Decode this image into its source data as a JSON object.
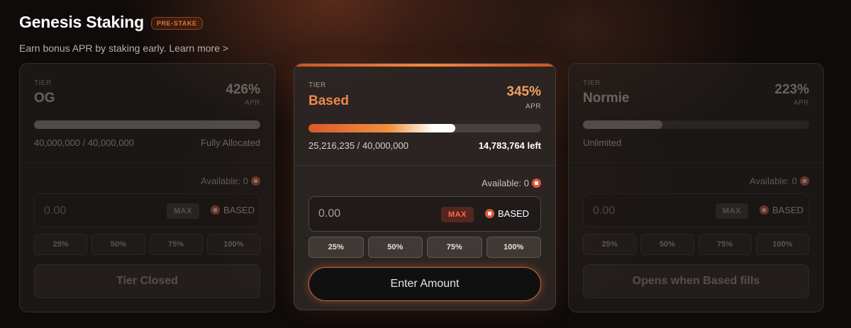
{
  "header": {
    "title": "Genesis Staking",
    "badge": "PRE-STAKE",
    "subtitle": "Earn bonus APR by staking early. Learn more >"
  },
  "colors": {
    "accent": "#f0874a",
    "token": "#e0583a",
    "background": "#0f0b0a"
  },
  "tiers": [
    {
      "tier_label": "TIER",
      "name": "OG",
      "apr": "426%",
      "apr_label": "APR",
      "progress": 1.0,
      "allocation": "40,000,000 / 40,000,000",
      "status": "Fully Allocated",
      "available": "Available: 0",
      "amount_placeholder": "0.00",
      "max_label": "MAX",
      "token": "BASED",
      "percent_buttons": [
        "25%",
        "50%",
        "75%",
        "100%"
      ],
      "action_label": "Tier Closed"
    },
    {
      "tier_label": "TIER",
      "name": "Based",
      "apr": "345%",
      "apr_label": "APR",
      "progress": 0.63,
      "allocation": "25,216,235 / 40,000,000",
      "status": "14,783,764 left",
      "available": "Available: 0",
      "amount_placeholder": "0.00",
      "max_label": "MAX",
      "token": "BASED",
      "percent_buttons": [
        "25%",
        "50%",
        "75%",
        "100%"
      ],
      "action_label": "Enter Amount"
    },
    {
      "tier_label": "TIER",
      "name": "Normie",
      "apr": "223%",
      "apr_label": "APR",
      "progress": 0.35,
      "allocation": "Unlimited",
      "status": "",
      "available": "Available: 0",
      "amount_placeholder": "0.00",
      "max_label": "MAX",
      "token": "BASED",
      "percent_buttons": [
        "25%",
        "50%",
        "75%",
        "100%"
      ],
      "action_label": "Opens when Based fills"
    }
  ]
}
